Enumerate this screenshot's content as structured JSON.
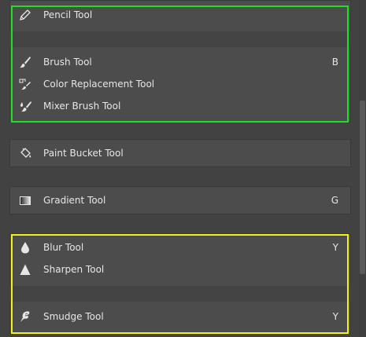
{
  "groups": [
    {
      "tools": [
        {
          "name": "Pencil Tool",
          "key": ""
        },
        {
          "name": "Brush Tool",
          "key": "B"
        },
        {
          "name": "Color Replacement Tool",
          "key": ""
        },
        {
          "name": "Mixer Brush Tool",
          "key": ""
        }
      ],
      "highlight_color": "#22dd22"
    },
    {
      "tools": [
        {
          "name": "Paint Bucket Tool",
          "key": ""
        }
      ]
    },
    {
      "tools": [
        {
          "name": "Gradient Tool",
          "key": "G"
        }
      ]
    },
    {
      "tools": [
        {
          "name": "Blur Tool",
          "key": "Y"
        },
        {
          "name": "Sharpen Tool",
          "key": ""
        },
        {
          "name": "Smudge Tool",
          "key": "Y"
        }
      ],
      "highlight_color": "#f2f21a"
    }
  ],
  "icons": [
    "pencil-icon",
    "brush-icon",
    "color-replacement-icon",
    "mixer-brush-icon",
    "paint-bucket-icon",
    "gradient-icon",
    "blur-icon",
    "sharpen-icon",
    "smudge-icon"
  ],
  "colors": {
    "background": "#424242",
    "panel": "#4c4c4c",
    "text": "#e6e6e6"
  }
}
